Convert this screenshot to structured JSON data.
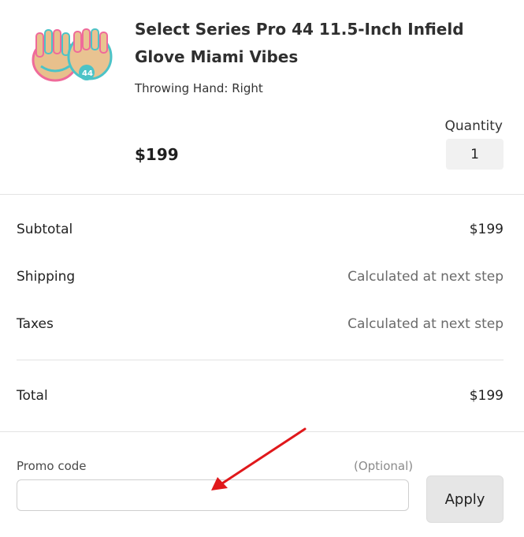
{
  "product": {
    "title": "Select Series Pro 44 11.5-Inch Infield Glove Miami Vibes",
    "variant": "Throwing Hand: Right",
    "price": "$199",
    "quantity_label": "Quantity",
    "quantity_value": "1",
    "thumbnail_colors": {
      "leather": "#e8c08c",
      "accent_pink": "#ef6a9a",
      "accent_teal": "#4cc3c7"
    }
  },
  "summary": {
    "rows": [
      {
        "label": "Subtotal",
        "value": "$199"
      },
      {
        "label": "Shipping",
        "value": "Calculated at next step"
      },
      {
        "label": "Taxes",
        "value": "Calculated at next step"
      }
    ],
    "total_label": "Total",
    "total_value": "$199"
  },
  "promo": {
    "label": "Promo code",
    "optional": "(Optional)",
    "value": "",
    "placeholder": "",
    "apply_label": "Apply"
  },
  "annotation": {
    "arrow_color": "#e0181b"
  }
}
